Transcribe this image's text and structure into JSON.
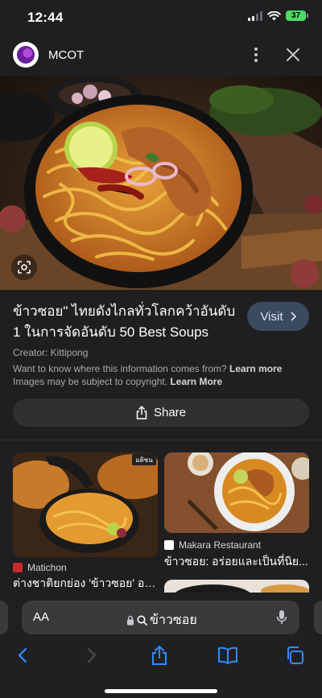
{
  "status_bar": {
    "time": "12:44",
    "battery": "37"
  },
  "app_bar": {
    "source": "MCOT"
  },
  "result": {
    "title": "ข้าวซอย\" ไทยดังไกลทั่วโลกคว้าอันดับ 1 ในการจัดอันดับ 50 Best Soups",
    "visit_label": "Visit",
    "creator": "Creator: Kittipong",
    "info_line1": "Want to know where this information comes from?",
    "learn_more_1": "Learn more",
    "info_line2": "Images may be subject to copyright.",
    "learn_more_2": "Learn More",
    "share_label": "Share"
  },
  "related": [
    {
      "source": "Matichon",
      "title": "ต่างชาติยกย่อง 'ข้าวซอย' อร่...",
      "favicon_color": "#c92a2a"
    },
    {
      "source": "Makara Restaurant",
      "title": "ข้าวซอย: อร่อยและเป็นที่นิย...",
      "favicon_color": "#ffffff"
    }
  ],
  "related_badge": "มติชน",
  "browser": {
    "aa_label": "AA",
    "query": "ข้าวซอย"
  },
  "colors": {
    "accent_visit": "#3b4a5f",
    "link_blue": "#2f8cff",
    "background": "#1f1f21"
  }
}
